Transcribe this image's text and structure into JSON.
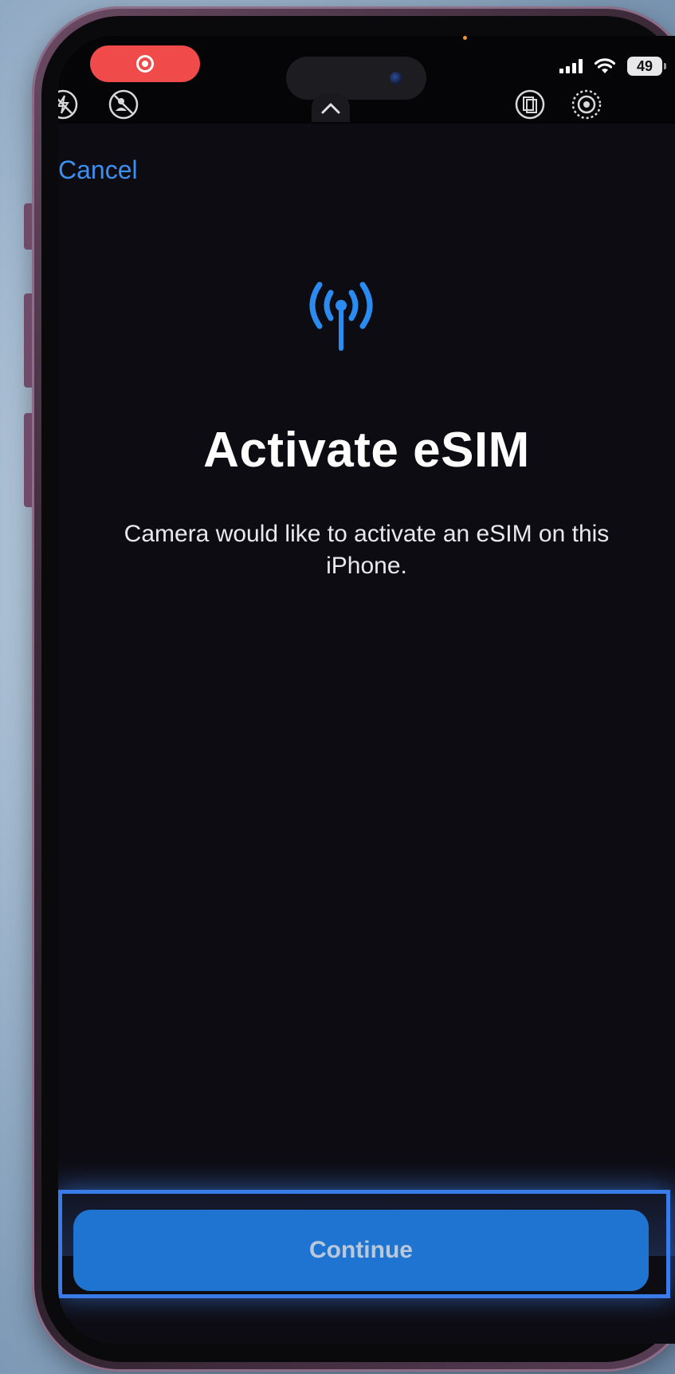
{
  "status_bar": {
    "battery_level": "49",
    "recording_indicator": "screen-record-icon"
  },
  "nav": {
    "cancel_label": "Cancel"
  },
  "content": {
    "icon": "antenna-broadcast-icon",
    "title": "Activate eSIM",
    "message": "Camera would like to activate an eSIM on this iPhone."
  },
  "footer": {
    "continue_label": "Continue"
  },
  "colors": {
    "accent": "#3b8ff0",
    "button": "#1f74d2",
    "record": "#f04a4a",
    "highlight_border": "#3a7bea"
  }
}
